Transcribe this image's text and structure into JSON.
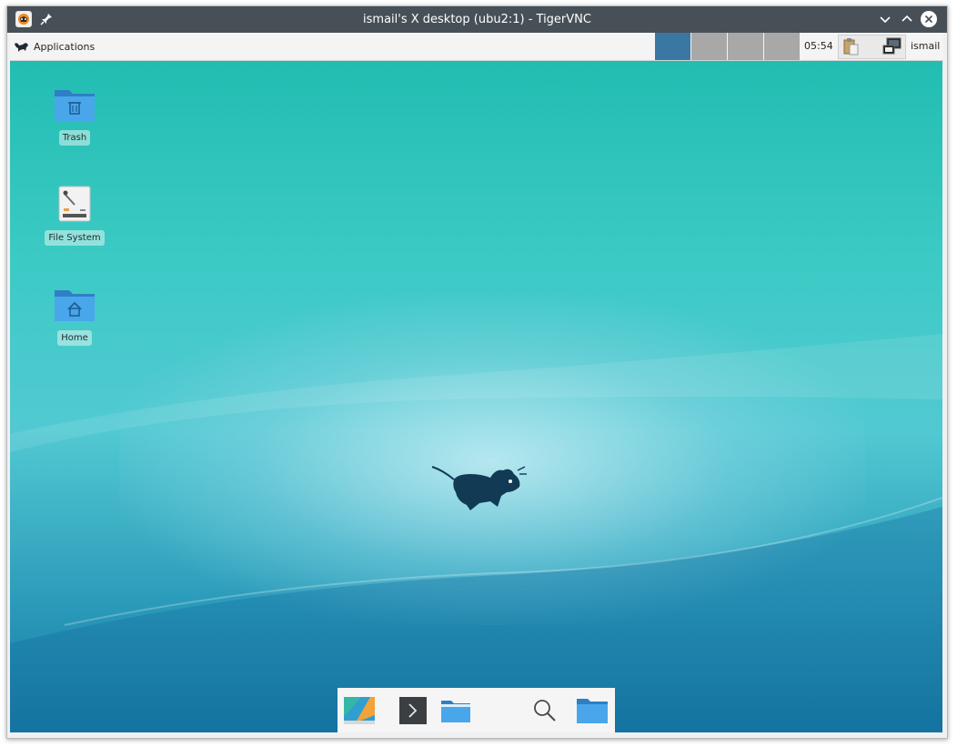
{
  "window": {
    "title": "ismail's X desktop (ubu2:1) - TigerVNC",
    "app_icon": "tigervnc-icon",
    "pin_icon": "pin-icon",
    "controls": [
      "minimize-icon",
      "maximize-icon",
      "close-icon"
    ]
  },
  "panel": {
    "applications_label": "Applications",
    "workspaces": [
      {
        "active": true
      },
      {
        "active": false
      },
      {
        "active": false
      },
      {
        "active": false
      }
    ],
    "clock": "05:54",
    "tray": [
      "clipboard-icon",
      "network-icon"
    ],
    "user": "ismail"
  },
  "desktop": {
    "icons": [
      {
        "label": "Trash",
        "icon": "trash-folder-icon"
      },
      {
        "label": "File System",
        "icon": "drive-icon"
      },
      {
        "label": "Home",
        "icon": "home-folder-icon"
      }
    ],
    "wallpaper_logo": "xfce-mouse-icon"
  },
  "dock": {
    "items": [
      "show-desktop-icon",
      "terminal-icon",
      "file-manager-icon",
      "search-icon",
      "folder-icon"
    ]
  },
  "colors": {
    "titlebar": "#475057",
    "active_workspace": "#3b77a3",
    "inactive_workspace": "#a8a8a8",
    "folder_blue": "#3d9ae8"
  }
}
